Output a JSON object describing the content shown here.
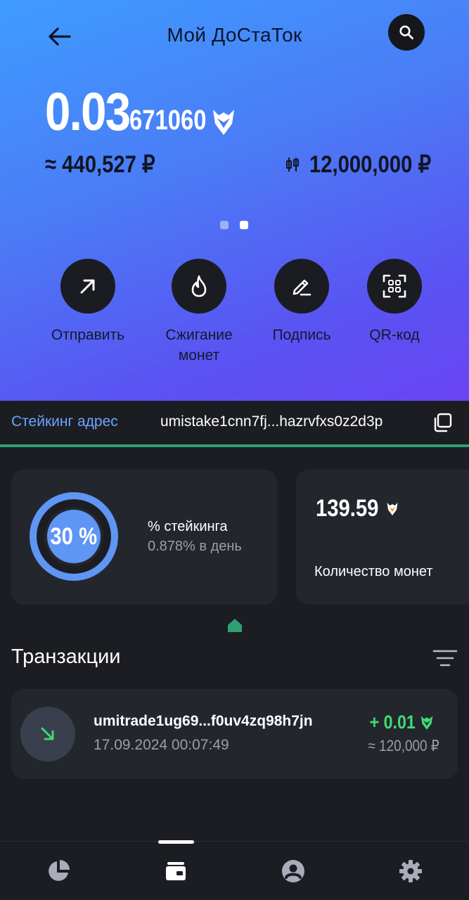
{
  "header": {
    "title": "Мой ДоСтаТок"
  },
  "balance": {
    "main": "0.03",
    "fraction": "671060",
    "rub_approx": "≈ 440,527 ₽",
    "limit_value": "12,000,000 ₽"
  },
  "pager": {
    "pages": 2,
    "active": 2
  },
  "actions": [
    {
      "label": "Отправить"
    },
    {
      "label": "Сжигание монет"
    },
    {
      "label": "Подпись"
    },
    {
      "label": "QR-код"
    }
  ],
  "staking": {
    "address_label": "Стейкинг адрес",
    "address": "umistake1cnn7fj...hazrvfxs0z2d3p",
    "percent": "30 %",
    "percent_value": 0.3,
    "percent_title": "% стейкинга",
    "daily": "0.878% в день",
    "coins_value": "139.59",
    "coins_label": "Количество монет"
  },
  "transactions": {
    "title": "Транзакции",
    "items": [
      {
        "address": "umitrade1ug69...f0uv4zq98h7jn",
        "date": "17.09.2024 00:07:49",
        "amount": "+ 0.01",
        "rub": "≈ 120,000 ₽"
      }
    ]
  },
  "bottom_nav": {
    "items": [
      {
        "icon": "pie-chart-icon"
      },
      {
        "icon": "wallet-icon"
      },
      {
        "icon": "profile-icon"
      },
      {
        "icon": "settings-icon"
      }
    ],
    "active": 1
  },
  "colors": {
    "accent_green": "#3fdc72",
    "link_blue": "#6aa4ff",
    "divider_green": "#2ea174",
    "coin_orange": "#f28c28"
  }
}
